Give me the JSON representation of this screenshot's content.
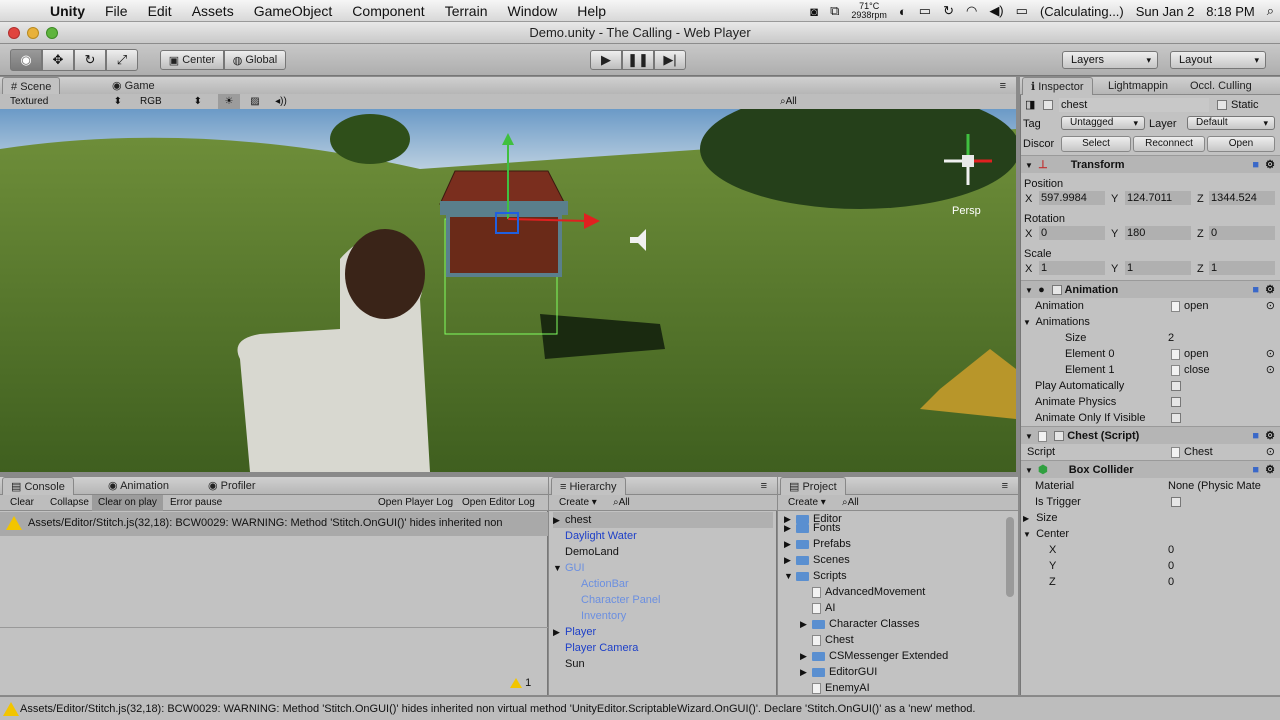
{
  "menubar": {
    "app": "Unity",
    "items": [
      "File",
      "Edit",
      "Assets",
      "GameObject",
      "Component",
      "Terrain",
      "Window",
      "Help"
    ],
    "temp": "71°C",
    "rpm": "2938rpm",
    "battery": "(Calculating...)",
    "date": "Sun Jan 2",
    "time": "8:18 PM"
  },
  "window": {
    "title": "Demo.unity - The Calling - Web Player"
  },
  "toolbar": {
    "center": "Center",
    "global": "Global",
    "layers": "Layers",
    "layout": "Layout"
  },
  "scene": {
    "tab_scene": "Scene",
    "tab_game": "Game",
    "render_mode": "Textured",
    "color_mode": "RGB",
    "search": "All",
    "persp": "Persp"
  },
  "inspector": {
    "tabs": [
      "Inspector",
      "Lightmappin",
      "Occl. Culling"
    ],
    "object_name": "chest",
    "static": "Static",
    "tag_label": "Tag",
    "tag_value": "Untagged",
    "layer_label": "Layer",
    "layer_value": "Default",
    "prefab_label": "Discor",
    "select": "Select",
    "reconnect": "Reconnect",
    "open": "Open",
    "transform": {
      "title": "Transform",
      "position_label": "Position",
      "pos": [
        "597.9984",
        "124.7011",
        "1344.524"
      ],
      "rotation_label": "Rotation",
      "rot": [
        "0",
        "180",
        "0"
      ],
      "scale_label": "Scale",
      "scale": [
        "1",
        "1",
        "1"
      ]
    },
    "animation": {
      "title": "Animation",
      "animation_label": "Animation",
      "animation_value": "open",
      "animations_label": "Animations",
      "size_label": "Size",
      "size_value": "2",
      "e0_label": "Element 0",
      "e0_value": "open",
      "e1_label": "Element 1",
      "e1_value": "close",
      "play_auto": "Play Automatically",
      "animate_physics": "Animate Physics",
      "animate_visible": "Animate Only If Visible"
    },
    "chest_script": {
      "title": "Chest (Script)",
      "script_label": "Script",
      "script_value": "Chest"
    },
    "box_collider": {
      "title": "Box Collider",
      "material_label": "Material",
      "material_value": "None (Physic Mate",
      "trigger_label": "Is Trigger",
      "size_label": "Size",
      "center_label": "Center",
      "x_label": "X",
      "y_label": "Y",
      "z_label": "Z",
      "x": "0",
      "y": "0",
      "z": "0"
    }
  },
  "console": {
    "tabs": [
      "Console",
      "Animation",
      "Profiler"
    ],
    "buttons": [
      "Clear",
      "Collapse",
      "Clear on play",
      "Error pause"
    ],
    "right_buttons": [
      "Open Player Log",
      "Open Editor Log"
    ],
    "message": "Assets/Editor/Stitch.js(32,18): BCW0029: WARNING: Method 'Stitch.OnGUI()' hides inherited non",
    "count": "1"
  },
  "hierarchy": {
    "title": "Hierarchy",
    "create": "Create",
    "search": "All",
    "items": [
      {
        "label": "chest",
        "indent": 0,
        "arrow": "▶",
        "color": "#111"
      },
      {
        "label": "Daylight Water",
        "indent": 0,
        "arrow": "",
        "color": "#1e40c8"
      },
      {
        "label": "DemoLand",
        "indent": 0,
        "arrow": "",
        "color": "#111"
      },
      {
        "label": "GUI",
        "indent": 0,
        "arrow": "▼",
        "color": "#6b8fe0"
      },
      {
        "label": "ActionBar",
        "indent": 1,
        "arrow": "",
        "color": "#6b8fe0"
      },
      {
        "label": "Character Panel",
        "indent": 1,
        "arrow": "",
        "color": "#6b8fe0"
      },
      {
        "label": "Inventory",
        "indent": 1,
        "arrow": "",
        "color": "#6b8fe0"
      },
      {
        "label": "Player",
        "indent": 0,
        "arrow": "▶",
        "color": "#1e40c8"
      },
      {
        "label": "Player Camera",
        "indent": 0,
        "arrow": "",
        "color": "#1e40c8"
      },
      {
        "label": "Sun",
        "indent": 0,
        "arrow": "",
        "color": "#111"
      }
    ]
  },
  "project": {
    "title": "Project",
    "create": "Create",
    "search": "All",
    "items": [
      {
        "label": "Editor",
        "indent": 0,
        "arrow": "▶",
        "type": "folder"
      },
      {
        "label": "Fonts",
        "indent": 0,
        "arrow": "▶",
        "type": "folder"
      },
      {
        "label": "Prefabs",
        "indent": 0,
        "arrow": "▶",
        "type": "folder"
      },
      {
        "label": "Scenes",
        "indent": 0,
        "arrow": "▶",
        "type": "folder"
      },
      {
        "label": "Scripts",
        "indent": 0,
        "arrow": "▼",
        "type": "folder"
      },
      {
        "label": "AdvancedMovement",
        "indent": 1,
        "arrow": "",
        "type": "file"
      },
      {
        "label": "AI",
        "indent": 1,
        "arrow": "",
        "type": "file"
      },
      {
        "label": "Character Classes",
        "indent": 1,
        "arrow": "▶",
        "type": "folder"
      },
      {
        "label": "Chest",
        "indent": 1,
        "arrow": "",
        "type": "file"
      },
      {
        "label": "CSMessenger Extended",
        "indent": 1,
        "arrow": "▶",
        "type": "folder"
      },
      {
        "label": "EditorGUI",
        "indent": 1,
        "arrow": "▶",
        "type": "folder"
      },
      {
        "label": "EnemyAI",
        "indent": 1,
        "arrow": "",
        "type": "file"
      }
    ]
  },
  "status": {
    "message": "Assets/Editor/Stitch.js(32,18): BCW0029: WARNING: Method 'Stitch.OnGUI()' hides inherited non virtual method 'UnityEditor.ScriptableWizard.OnGUI()'. Declare 'Stitch.OnGUI()' as a 'new' method."
  },
  "colors": {
    "warning": "#f2c500",
    "prefab_blue": "#1e40c8",
    "gizmo_x": "#e02020",
    "gizmo_y": "#40c040",
    "gizmo_z": "#2060e0"
  }
}
